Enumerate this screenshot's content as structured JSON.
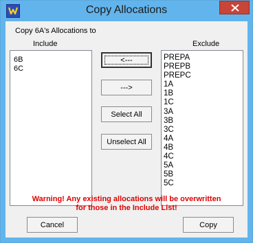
{
  "window": {
    "title": "Copy Allocations",
    "accent": "#62b4ec",
    "close_color": "#c84537"
  },
  "dialog": {
    "heading": "Copy 6A's Allocations to",
    "include_label": "Include",
    "exclude_label": "Exclude",
    "include_items": [
      "6B",
      "6C"
    ],
    "exclude_items": [
      "PREPA",
      "PREPB",
      "PREPC",
      "1A",
      "1B",
      "1C",
      "3A",
      "3B",
      "3C",
      "4A",
      "4B",
      "4C",
      "5A",
      "5B",
      "5C"
    ],
    "buttons": {
      "move_left": "<---",
      "move_right": "--->",
      "select_all": "Select All",
      "unselect_all": "Unselect All",
      "cancel": "Cancel",
      "copy": "Copy"
    },
    "warning_line1": "Warning! Any existing allocations will be overwritten",
    "warning_line2": "for those in the Include List!",
    "warning_color": "#e00000"
  }
}
